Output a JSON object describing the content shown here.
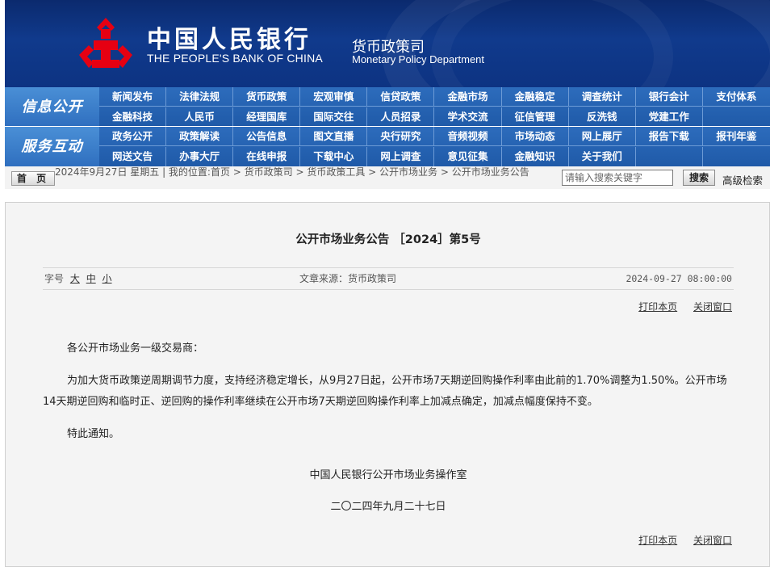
{
  "header": {
    "bank_name_cn": "中国人民银行",
    "bank_name_en": "THE PEOPLE'S BANK OF CHINA",
    "dept_cn": "货币政策司",
    "dept_en": "Monetary Policy Department",
    "logo_icon": "pboc-logo-icon",
    "logo_color": "#e60012"
  },
  "nav": {
    "section1_label": "信息公开",
    "section2_label": "服务互动",
    "row1": [
      "新闻发布",
      "法律法规",
      "货币政策",
      "宏观审慎",
      "信贷政策",
      "金融市场",
      "金融稳定",
      "调查统计",
      "银行会计",
      "支付体系"
    ],
    "row2": [
      "金融科技",
      "人民币",
      "经理国库",
      "国际交往",
      "人员招录",
      "学术交流",
      "征信管理",
      "反洗钱",
      "党建工作",
      ""
    ],
    "row3": [
      "政务公开",
      "政策解读",
      "公告信息",
      "图文直播",
      "央行研究",
      "音频视频",
      "市场动态",
      "网上展厅",
      "报告下载",
      "报刊年鉴"
    ],
    "row4": [
      "网送文告",
      "办事大厅",
      "在线申报",
      "下载中心",
      "网上调查",
      "意见征集",
      "金融知识",
      "关于我们",
      "",
      ""
    ]
  },
  "crumbbar": {
    "home_label": "首 页",
    "date_text": "2024年9月27日 星期五 | 我的位置:首页 > 货币政策司 > 货币政策工具 > 公开市场业务 > 公开市场业务公告",
    "search_placeholder": "请输入搜索关键字",
    "search_button": "搜索",
    "advanced_search": "高级检索"
  },
  "article": {
    "title": "公开市场业务公告 ［2024］第5号",
    "font_size_label": "字号",
    "size_large": "大",
    "size_medium": "中",
    "size_small": "小",
    "source": "文章来源：货币政策司",
    "pubdate": "2024-09-27 08:00:00",
    "print": "打印本页",
    "close": "关闭窗口",
    "salutation": "各公开市场业务一级交易商：",
    "paragraph": "为加大货币政策逆周期调节力度，支持经济稳定增长，从9月27日起，公开市场7天期逆回购操作利率由此前的1.70%调整为1.50%。公开市场14天期逆回购和临时正、逆回购的操作利率继续在公开市场7天期逆回购操作利率上加减点确定，加减点幅度保持不变。",
    "closing": "特此通知。",
    "signature_org": "中国人民银行公开市场业务操作室",
    "signature_date": "二〇二四年九月二十七日"
  },
  "colors": {
    "header_bg": "#103a8c",
    "nav_bg": "#2d6cbc",
    "panel_bg": "#f4f4f4"
  }
}
